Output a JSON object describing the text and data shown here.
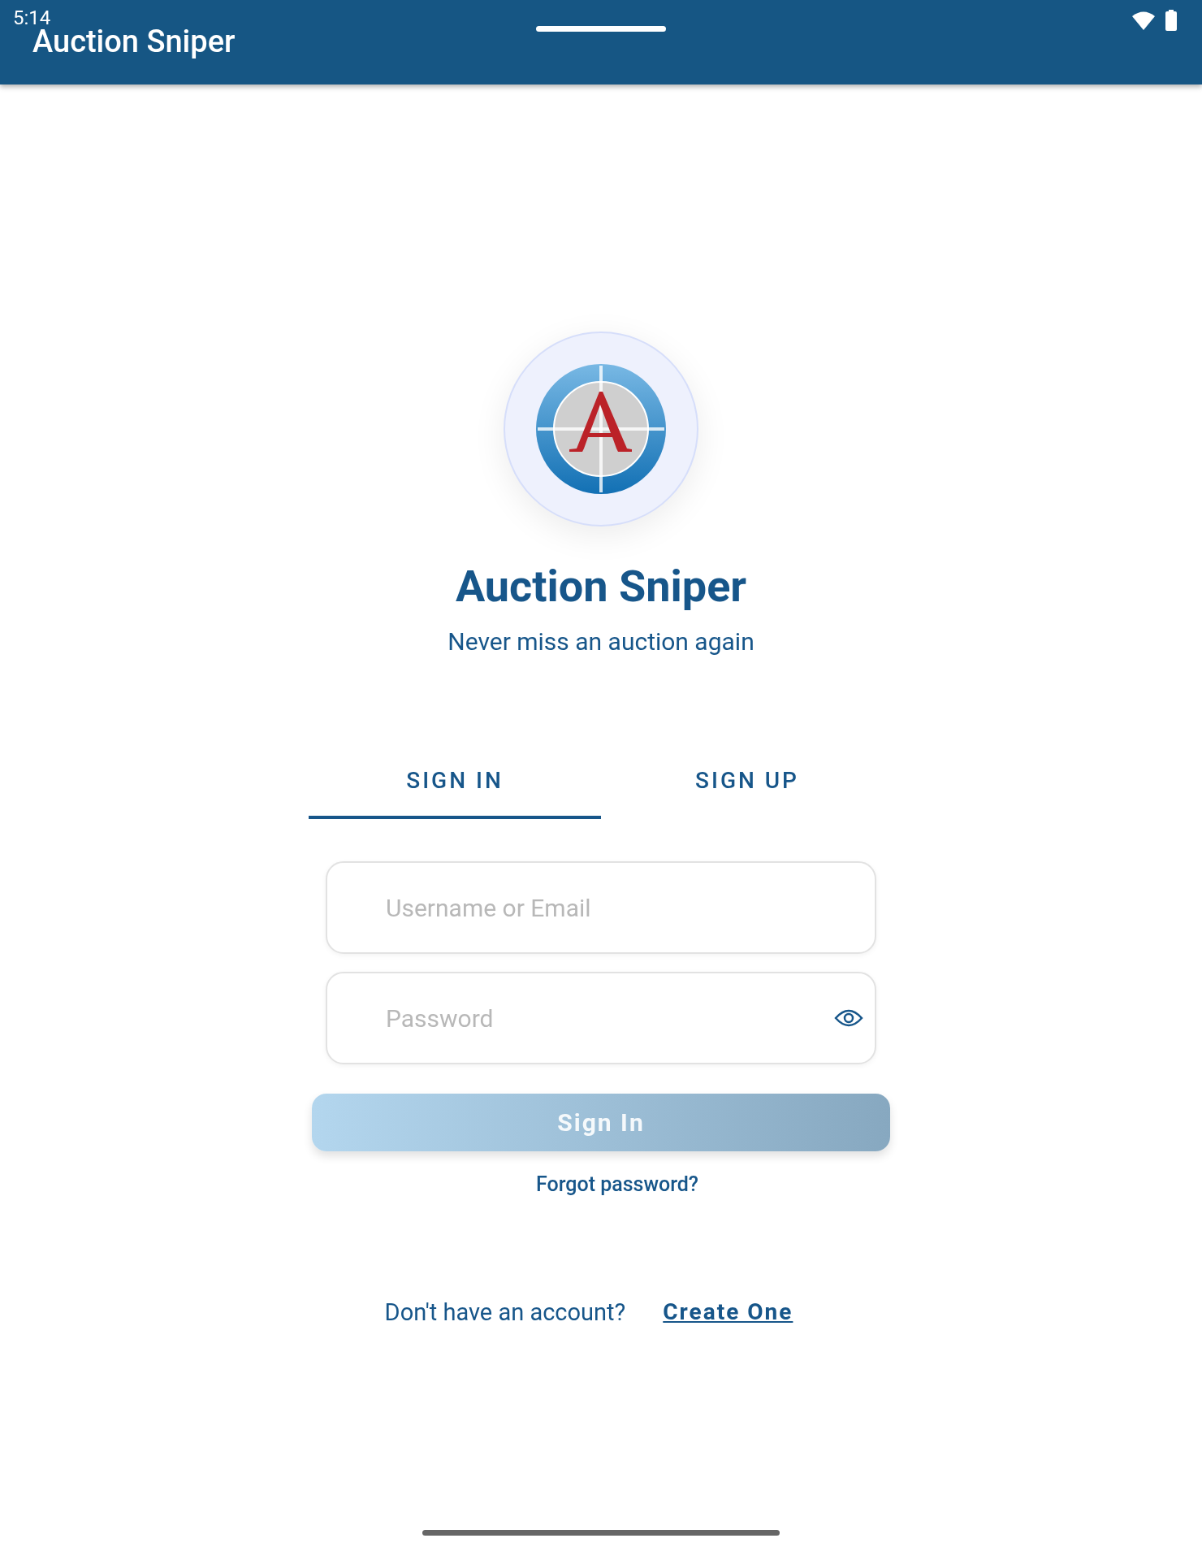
{
  "status_bar": {
    "time": "5:14"
  },
  "app_bar": {
    "title": "Auction Sniper"
  },
  "brand": {
    "title": "Auction Sniper",
    "tagline": "Never miss an auction again"
  },
  "tabs": [
    {
      "label": "SIGN IN",
      "selected": true
    },
    {
      "label": "SIGN UP",
      "selected": false
    }
  ],
  "fields": [
    {
      "placeholder": "Username or Email",
      "kind": "text"
    },
    {
      "placeholder": "Password",
      "kind": "password"
    }
  ],
  "submit": {
    "label": "Sign In",
    "disabled": true
  },
  "forgot_link": "Forgot password?",
  "footer": {
    "prompt": "Don't have an account?",
    "link": "Create One"
  }
}
